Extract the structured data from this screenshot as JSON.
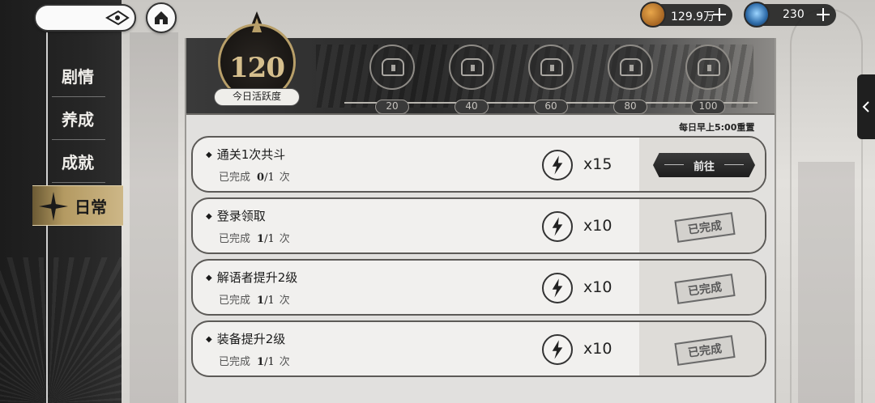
{
  "sidebar": {
    "items": [
      {
        "label": "剧情"
      },
      {
        "label": "养成"
      },
      {
        "label": "成就"
      },
      {
        "label": "日常",
        "active": true
      }
    ]
  },
  "currency": {
    "coins": {
      "value": "129.9万",
      "icon": "coin-icon"
    },
    "gems": {
      "value": "230",
      "icon": "crystal-icon"
    }
  },
  "activity": {
    "score": "120",
    "label": "今日活跃度",
    "milestones": [
      "20",
      "40",
      "60",
      "80",
      "100"
    ]
  },
  "reset_note": "每日早上5:00重置",
  "tasks": [
    {
      "title": "通关1次共斗",
      "status": "已完成",
      "current": "0",
      "total": "/1",
      "unit": "次",
      "reward": "x15",
      "action": "前往"
    },
    {
      "title": "登录领取",
      "status": "已完成",
      "current": "1",
      "total": "/1",
      "unit": "次",
      "reward": "x10",
      "stamp": "已完成"
    },
    {
      "title": "解语者提升2级",
      "status": "已完成",
      "current": "1",
      "total": "/1",
      "unit": "次",
      "reward": "x10",
      "stamp": "已完成"
    },
    {
      "title": "装备提升2级",
      "status": "已完成",
      "current": "1",
      "total": "/1",
      "unit": "次",
      "reward": "x10",
      "stamp": "已完成"
    }
  ],
  "colors": {
    "accent_gold": "#b89f69",
    "dark": "#1e1e1e",
    "card": "#f1f0ee"
  }
}
